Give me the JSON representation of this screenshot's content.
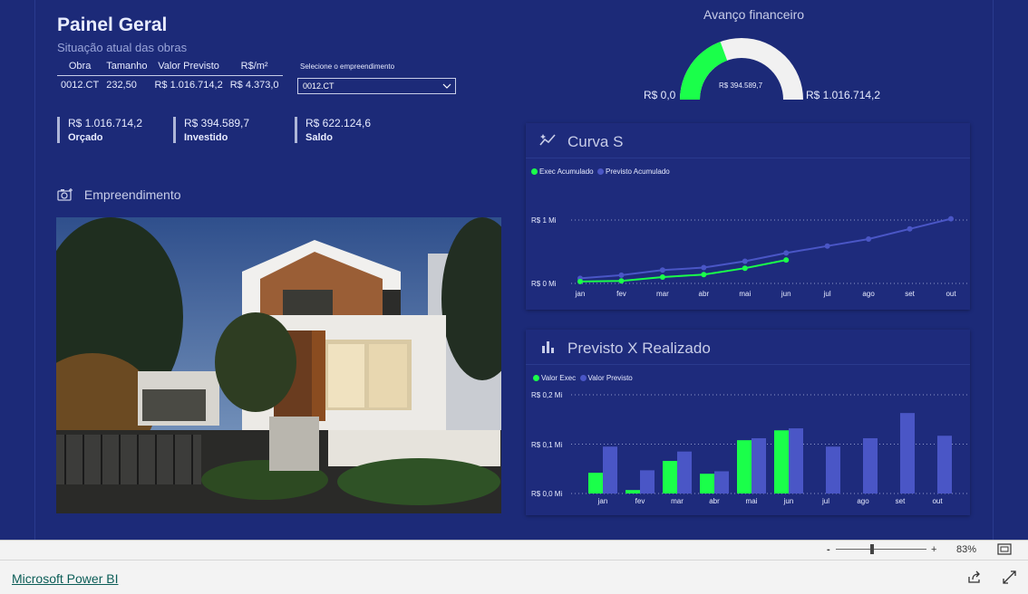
{
  "header": {
    "title": "Painel Geral",
    "subtitle": "Situação atual das obras"
  },
  "info_table": {
    "columns": [
      "Obra",
      "Tamanho",
      "Valor Previsto",
      "R$/m²"
    ],
    "row": [
      "0012.CT",
      "232,50",
      "R$ 1.016.714,2",
      "R$ 4.373,0"
    ]
  },
  "selector": {
    "label": "Selecione o empreendimento",
    "value": "0012.CT"
  },
  "kpis": [
    {
      "value": "R$ 1.016.714,2",
      "label": "Orçado"
    },
    {
      "value": "R$ 394.589,7",
      "label": "Investido"
    },
    {
      "value": "R$ 622.124,6",
      "label": "Saldo"
    }
  ],
  "empreendimento": {
    "title": "Empreendimento"
  },
  "gauge": {
    "title": "Avanço financeiro",
    "min_label": "R$ 0,0",
    "max_label": "R$ 1.016.714,2",
    "value_label": "R$ 394.589,7",
    "value": 394589.7,
    "max": 1016714.2,
    "colors": {
      "fill": "#1aff4a",
      "track": "#f1f1f1"
    }
  },
  "curva_s": {
    "title": "Curva S",
    "legend": [
      "Exec Acumulado",
      "Previsto Acumulado"
    ],
    "y_ticks": [
      "R$ 1 Mi",
      "R$ 0 Mi"
    ]
  },
  "previsto_realizado": {
    "title": "Previsto X Realizado",
    "legend": [
      "Valor Exec",
      "Valor Previsto"
    ],
    "y_ticks": [
      "R$ 0,2 Mi",
      "R$ 0,1 Mi",
      "R$ 0,0 Mi"
    ]
  },
  "chart_data": [
    {
      "type": "line",
      "title": "Curva S",
      "categories": [
        "jan",
        "fev",
        "mar",
        "abr",
        "mai",
        "jun",
        "jul",
        "ago",
        "set",
        "out"
      ],
      "ylim": [
        0,
        1.2
      ],
      "y_unit": "R$ Mi",
      "series": [
        {
          "name": "Exec Acumulado",
          "color": "#1aff4a",
          "values": [
            0.03,
            0.04,
            0.1,
            0.14,
            0.24,
            0.37,
            null,
            null,
            null,
            null
          ]
        },
        {
          "name": "Previsto Acumulado",
          "color": "#4a56c6",
          "values": [
            0.08,
            0.13,
            0.21,
            0.25,
            0.35,
            0.48,
            0.59,
            0.7,
            0.86,
            1.02
          ]
        }
      ],
      "grid": true,
      "legend_position": "top-left"
    },
    {
      "type": "bar",
      "title": "Previsto X Realizado",
      "categories": [
        "jan",
        "fev",
        "mar",
        "abr",
        "mai",
        "jun",
        "jul",
        "ago",
        "set",
        "out"
      ],
      "ylim": [
        0,
        0.2
      ],
      "y_unit": "R$ Mi",
      "series": [
        {
          "name": "Valor Exec",
          "color": "#1aff4a",
          "values": [
            0.042,
            0.007,
            0.066,
            0.04,
            0.108,
            0.128,
            null,
            null,
            null,
            null
          ]
        },
        {
          "name": "Valor Previsto",
          "color": "#4a56c6",
          "values": [
            0.095,
            0.047,
            0.085,
            0.045,
            0.112,
            0.132,
            0.095,
            0.112,
            0.163,
            0.117
          ]
        }
      ],
      "grid": true,
      "legend_position": "top-left"
    }
  ],
  "footer": {
    "zoom_minus": "-",
    "zoom_plus": "+",
    "zoom_level": "83%",
    "powerbi_link": "Microsoft Power BI"
  }
}
